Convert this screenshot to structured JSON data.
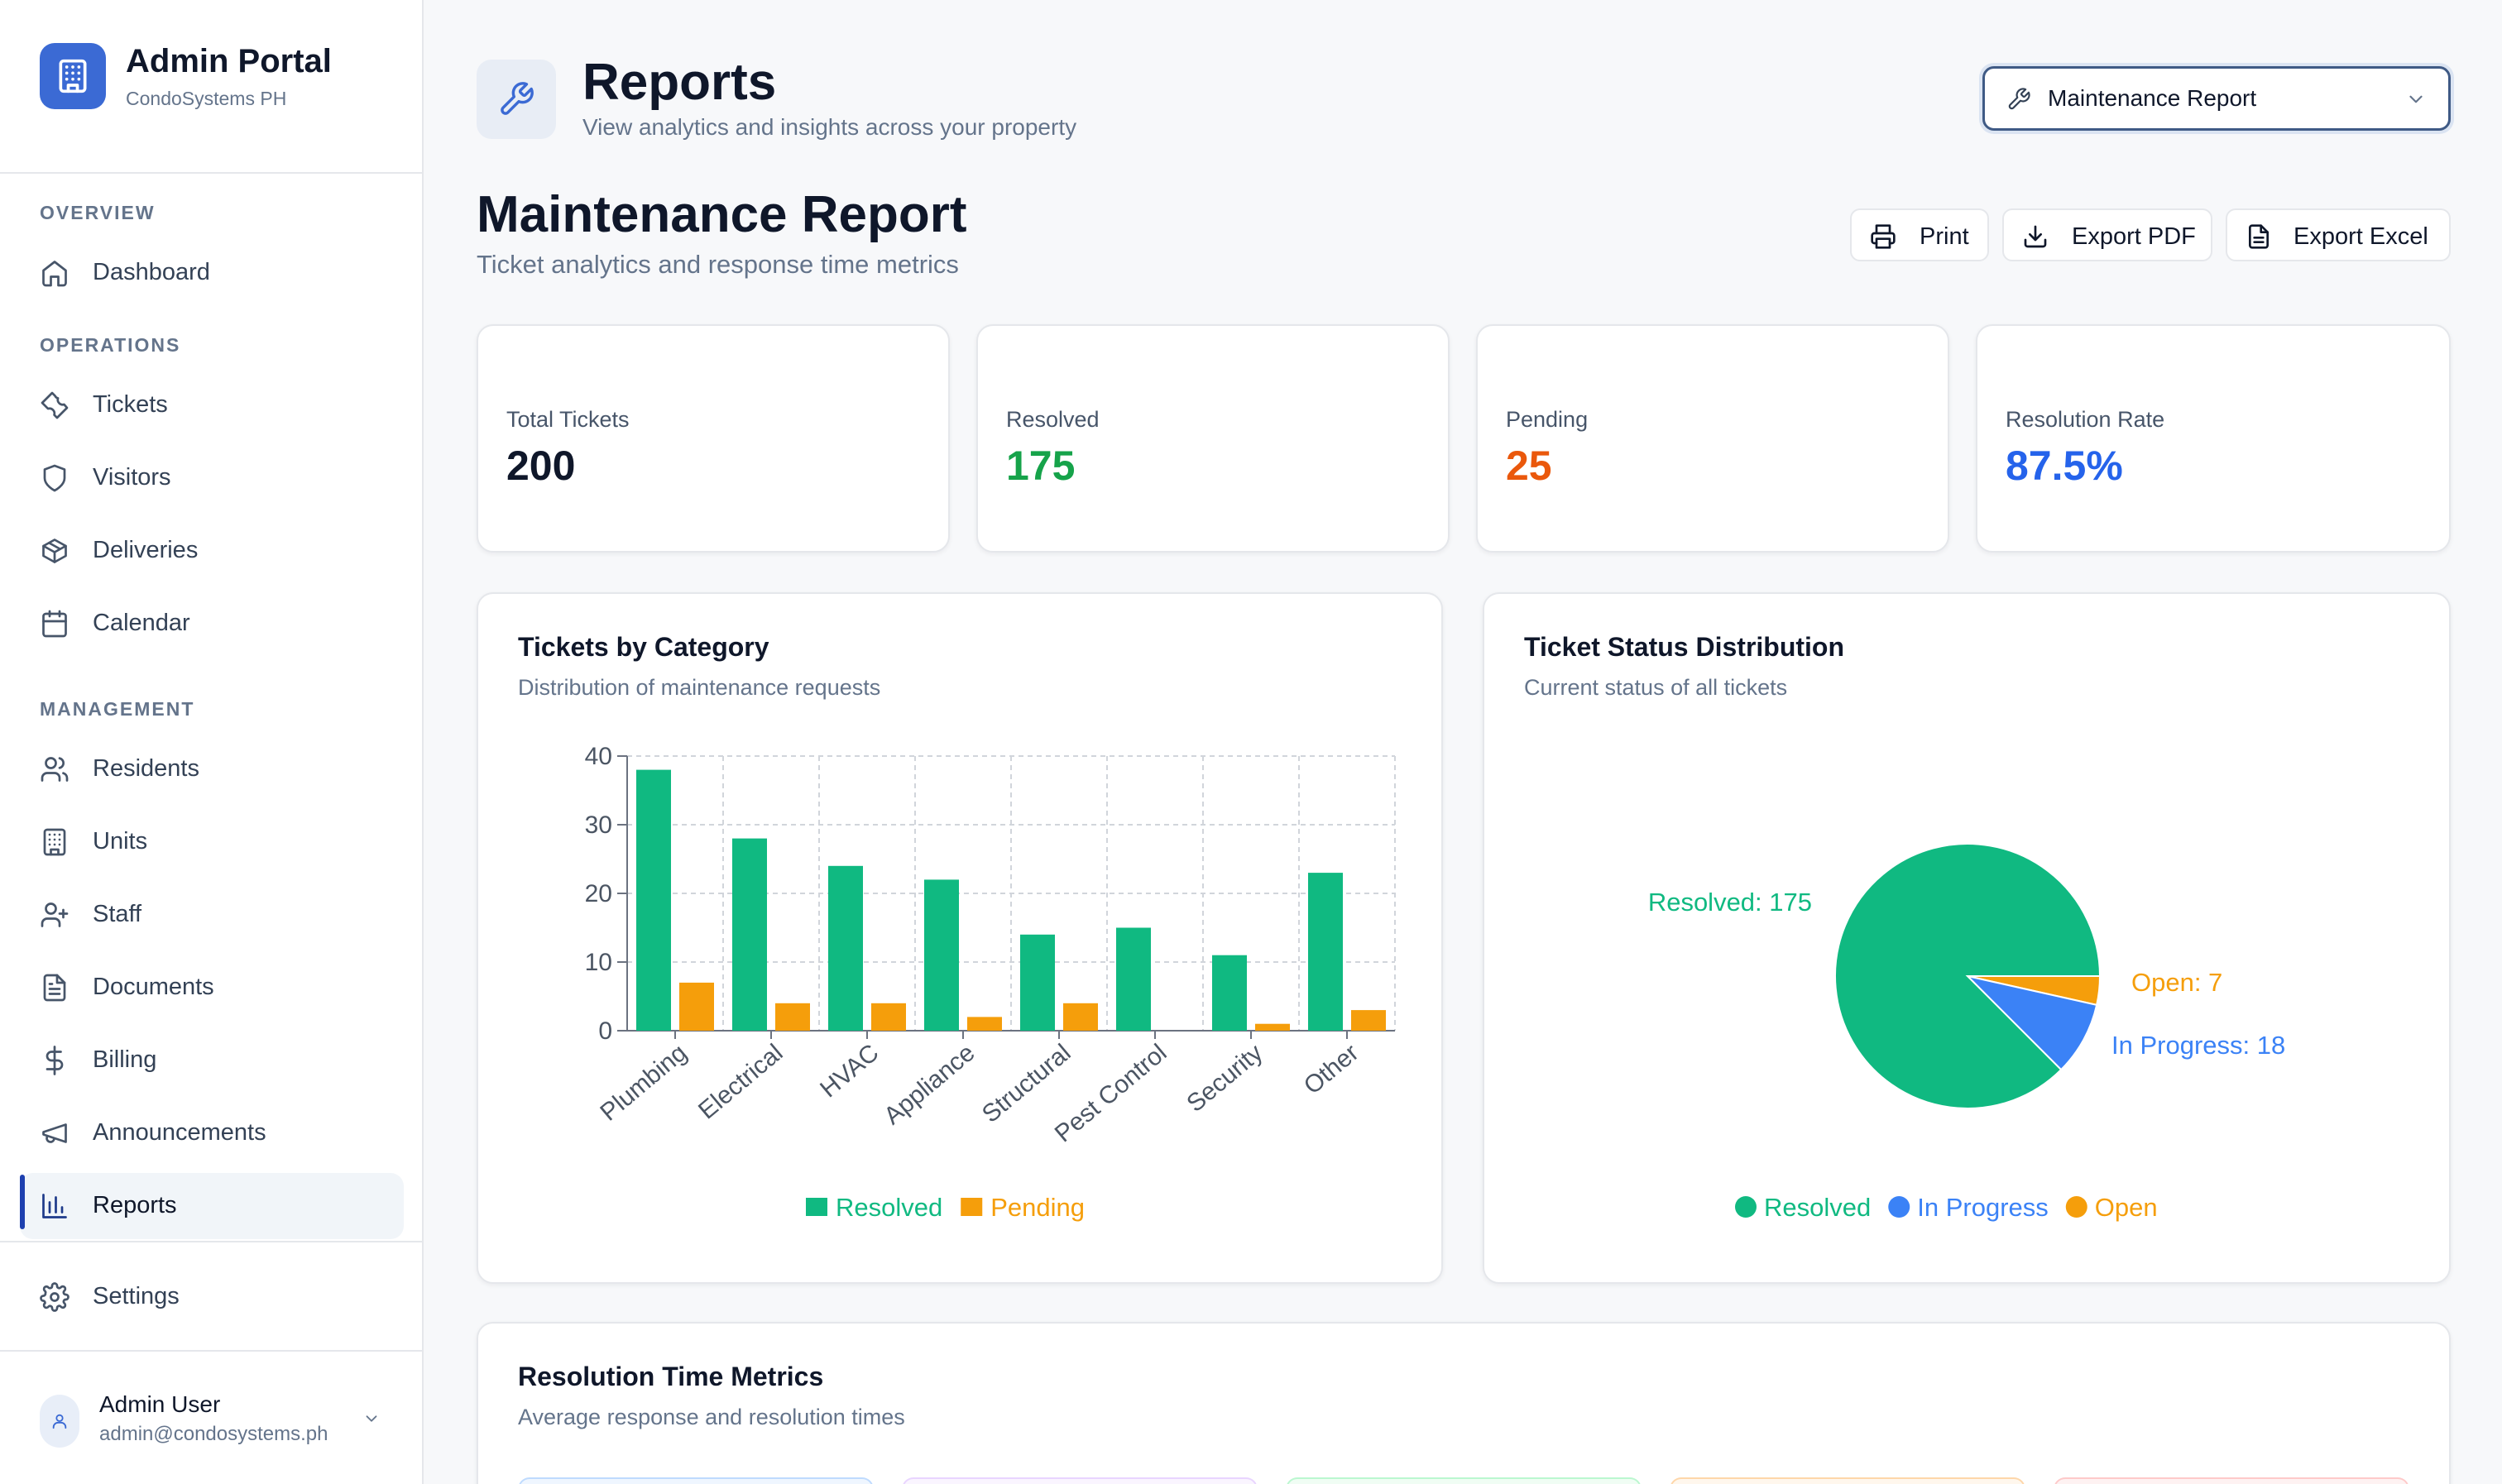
{
  "sidebar": {
    "brand_title": "Admin Portal",
    "brand_subtitle": "CondoSystems PH",
    "sections": {
      "overview": "OVERVIEW",
      "operations": "OPERATIONS",
      "management": "MANAGEMENT"
    },
    "items": {
      "dashboard": "Dashboard",
      "tickets": "Tickets",
      "visitors": "Visitors",
      "deliveries": "Deliveries",
      "calendar": "Calendar",
      "residents": "Residents",
      "units": "Units",
      "staff": "Staff",
      "documents": "Documents",
      "billing": "Billing",
      "announcements": "Announcements",
      "reports": "Reports",
      "settings": "Settings"
    },
    "active_item": "reports",
    "user": {
      "name": "Admin User",
      "email": "admin@condosystems.ph"
    }
  },
  "header": {
    "title": "Reports",
    "subtitle": "View analytics and insights across your property",
    "report_select_value": "Maintenance Report",
    "icon": "wrench-icon"
  },
  "report": {
    "title": "Maintenance Report",
    "subtitle": "Ticket analytics and response time metrics",
    "actions": {
      "print": "Print",
      "export_pdf": "Export PDF",
      "export_excel": "Export Excel"
    }
  },
  "stats": [
    {
      "label": "Total Tickets",
      "value": "200",
      "color": "#0f172a"
    },
    {
      "label": "Resolved",
      "value": "175",
      "color": "#16a34a"
    },
    {
      "label": "Pending",
      "value": "25",
      "color": "#ea580c"
    },
    {
      "label": "Resolution Rate",
      "value": "87.5%",
      "color": "#2563eb"
    }
  ],
  "category_card": {
    "title": "Tickets by Category",
    "subtitle": "Distribution of maintenance requests"
  },
  "status_card": {
    "title": "Ticket Status Distribution",
    "subtitle": "Current status of all tickets"
  },
  "resolution_card": {
    "title": "Resolution Time Metrics",
    "subtitle": "Average response and resolution times"
  },
  "colors": {
    "resolved": "#10b981",
    "pending": "#f59e0b",
    "in_progress": "#3b82f6",
    "open": "#f59e0b",
    "accent": "#3b6ad4"
  },
  "chart_data": [
    {
      "type": "bar",
      "title": "Tickets by Category",
      "categories": [
        "Plumbing",
        "Electrical",
        "HVAC",
        "Appliance",
        "Structural",
        "Pest Control",
        "Security",
        "Other"
      ],
      "series": [
        {
          "name": "Resolved",
          "values": [
            38,
            28,
            24,
            22,
            14,
            15,
            11,
            23
          ]
        },
        {
          "name": "Pending",
          "values": [
            7,
            4,
            4,
            2,
            4,
            0,
            1,
            3
          ]
        }
      ],
      "yticks": [
        "0",
        "10",
        "20",
        "30",
        "40"
      ],
      "ylim": [
        0,
        40
      ],
      "grid": true,
      "legend": "bottom"
    },
    {
      "type": "pie",
      "title": "Ticket Status Distribution",
      "slices": [
        {
          "name": "Resolved",
          "value": 175,
          "label": "Resolved: 175"
        },
        {
          "name": "In Progress",
          "value": 18,
          "label": "In Progress: 18"
        },
        {
          "name": "Open",
          "value": 7,
          "label": "Open: 7"
        }
      ],
      "legend": "bottom"
    }
  ]
}
